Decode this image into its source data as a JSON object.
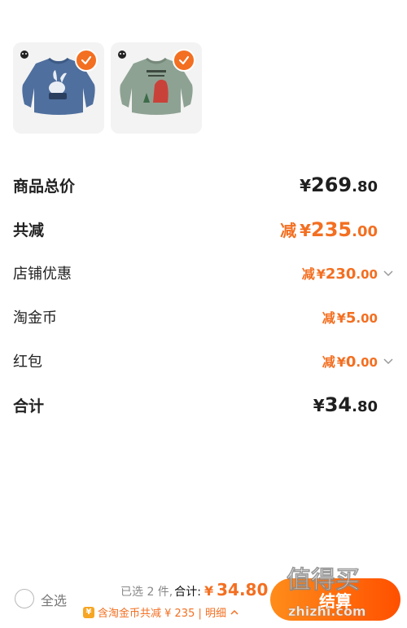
{
  "products": [
    {
      "name": "blue-sweater",
      "selected": true,
      "color": "#4f6f9e"
    },
    {
      "name": "green-sweater",
      "selected": true,
      "color": "#8ea293"
    }
  ],
  "rows": {
    "subtotal": {
      "label": "商品总价",
      "yen": "¥",
      "int": "269",
      "dec": ".80"
    },
    "total_discount": {
      "label": "共减",
      "prefix": "减",
      "yen": "¥",
      "int": "235",
      "dec": ".00"
    },
    "shop_discount": {
      "label": "店铺优惠",
      "prefix": "减",
      "yen": "¥",
      "int": "230",
      "dec": ".00"
    },
    "taojinbi": {
      "label": "淘金币",
      "prefix": "减",
      "yen": "¥",
      "int": "5",
      "dec": ".00"
    },
    "red_packet": {
      "label": "红包",
      "prefix": "减",
      "yen": "¥",
      "int": "0",
      "dec": ".00"
    },
    "total": {
      "label": "合计",
      "yen": "¥",
      "int": "34",
      "dec": ".80"
    }
  },
  "bottom": {
    "select_all": "全选",
    "selected_count": "已选 2 件,",
    "total_label": "合计:",
    "total_yen": "¥",
    "total_value": "34.80",
    "coin_note": "含淘金币共减 ¥ 235 | 明细",
    "coin_icon": "¥",
    "checkout": "结算"
  },
  "watermark": {
    "text": "值得买",
    "domain": "zhizhi.com"
  },
  "colors": {
    "accent": "#f36f21",
    "text": "#1f1f1f"
  }
}
